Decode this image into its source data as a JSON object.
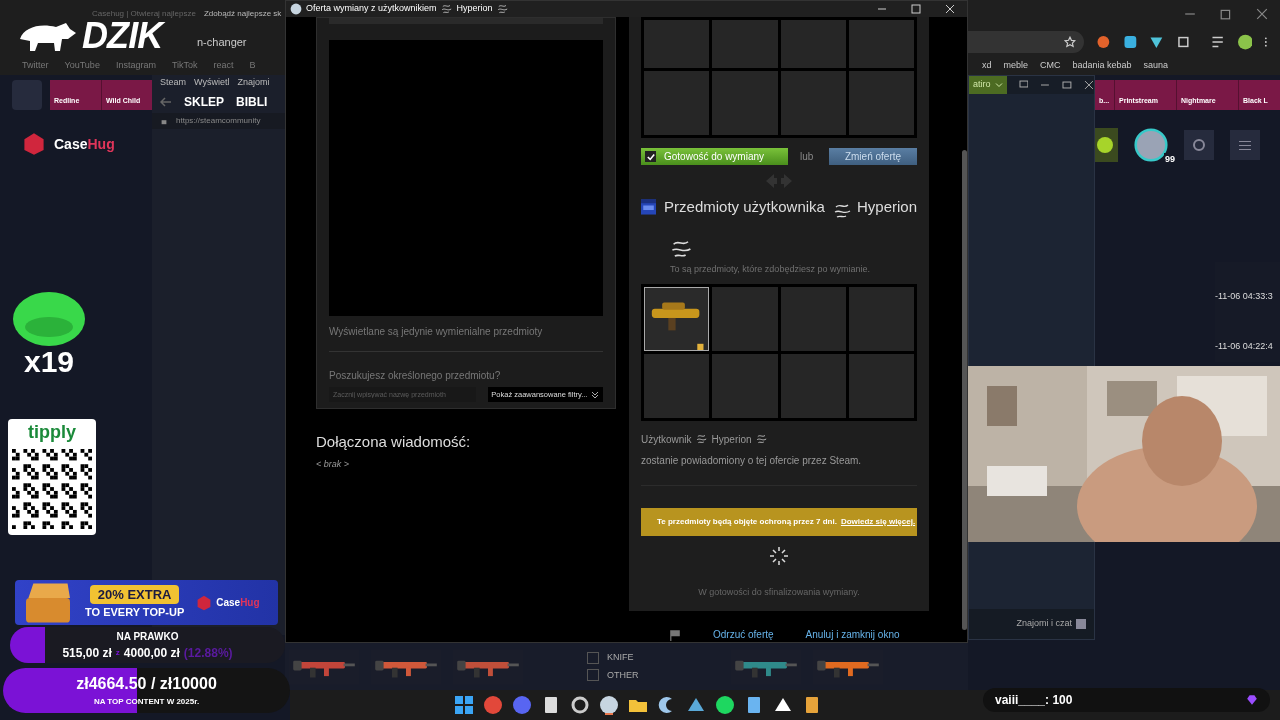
{
  "left_browser": {
    "tabs": [
      "Casehug | Otwieraj najlepsze",
      "Zdobądź najlepsze sk"
    ],
    "address": "n-changer",
    "bookmarks": [
      "Twitter",
      "YouTube",
      "Instagram",
      "TikTok",
      "react",
      "B"
    ]
  },
  "right_browser": {
    "bookmarks": [
      "xd",
      "meble",
      "CMC",
      "badania kebab",
      "sauna"
    ]
  },
  "overlay_logo": "DZIK",
  "steam_client": {
    "menu": [
      "Steam",
      "Wyświetl",
      "Znajomi"
    ],
    "nav": [
      "SKLEP",
      "BIBLI"
    ],
    "url": "https://steamcommunity"
  },
  "casehug": {
    "logo": [
      "Case",
      "Hug"
    ],
    "skins_left": [
      "Redline",
      "Wild Child"
    ],
    "skins_right": [
      "b...",
      "Printstream",
      "Nightmare",
      "Black L"
    ],
    "avatar_badge": "99",
    "timestamps": [
      "-11-06 04:33:3",
      "-11-06 04:22:4"
    ],
    "filters": [
      {
        "label": "KNIFE",
        "checked": false
      },
      {
        "label": "OTHER",
        "checked": false
      }
    ]
  },
  "friends_window": {
    "account": "atiro",
    "footer": "Znajomi i czat"
  },
  "trade": {
    "title": "Oferta wymiany z użytkownikiem",
    "title_partner": "Hyperion",
    "inventory_note": "Wyświetlane są jedynie wymienialne przedmioty",
    "search_label": "Poszukujesz określonego przedmiotu?",
    "search_placeholder": "Zacznij wpisywać nazwę przedmioth",
    "filters_button": "Pokaż zaawansowane filtry...",
    "message_heading": "Dołączona wiadomość:",
    "message": "< brak >",
    "ready": {
      "label": "Gotowość do wymiany",
      "checked": true
    },
    "or": "lub",
    "change_button": "Zmień ofertę",
    "their_heading": "Przedmioty użytkownika",
    "their_partner": "Hyperion",
    "their_note": "To są przedmioty, które zdobędziesz po wymianie.",
    "their_slots": [
      {
        "kind": "item"
      },
      {
        "kind": "empty"
      },
      {
        "kind": "empty"
      },
      {
        "kind": "empty"
      },
      {
        "kind": "empty"
      },
      {
        "kind": "empty"
      },
      {
        "kind": "empty"
      },
      {
        "kind": "empty"
      }
    ],
    "notify": {
      "before": "Użytkownik",
      "partner": "Hyperion",
      "after": "zostanie powiadomiony o tej ofercie przez Steam."
    },
    "protection": {
      "text": "Te przedmioty będą objęte ochroną przez 7 dni.",
      "link": "Dowiedz się więcej."
    },
    "status": "W gotowości do sfinalizowania wymiany.",
    "footer": [
      "Odrzuć ofertę",
      "Anuluj i zamknij okno"
    ]
  },
  "overlays": {
    "mascot_count": "x19",
    "tipply": "tipply",
    "promo": {
      "headline": "20% EXTRA",
      "subline": "TO EVERY TOP-UP",
      "brand": [
        "Case",
        "Hug"
      ]
    },
    "goal1": {
      "title": "NA PRAWKO",
      "current": "515,00 zł",
      "sep": "z",
      "target": "4000,00 zł",
      "percent": "(12.88%)",
      "level": 0.1288
    },
    "goal2": {
      "amount": "zł4664.50 / zł10000",
      "caption": "NA TOP CONTENT W 2025r.",
      "level": 0.4665
    },
    "chat": "vaiii____: 100"
  }
}
